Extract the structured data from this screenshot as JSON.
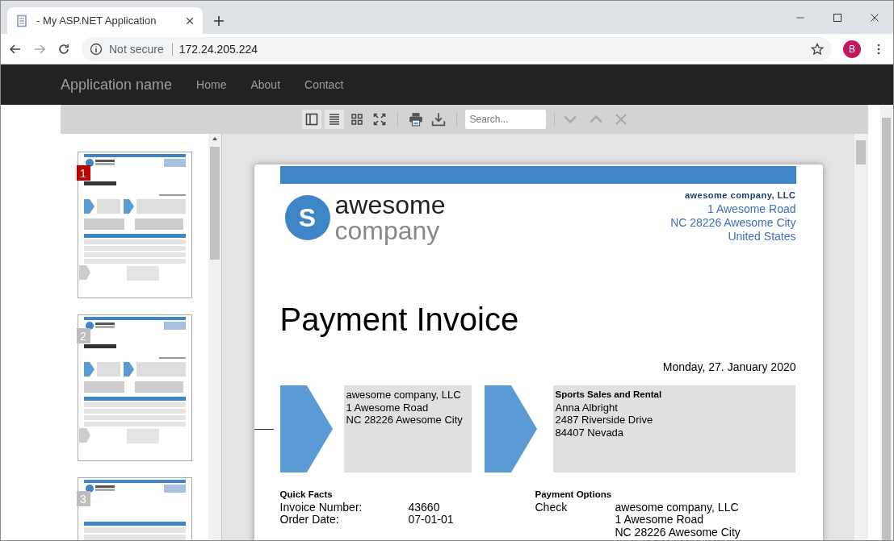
{
  "browser": {
    "tab_title": "- My ASP.NET Application",
    "security": "Not secure",
    "url": "172.24.205.224",
    "profile_initial": "B"
  },
  "navbar": {
    "brand": "Application name",
    "links": [
      "Home",
      "About",
      "Contact"
    ]
  },
  "toolbar": {
    "search": {
      "placeholder": "Search..."
    },
    "buttons": [
      {
        "kind": "sidebar",
        "selected": true
      },
      {
        "kind": "continuous",
        "selected": true
      },
      {
        "kind": "grid",
        "selected": false
      },
      {
        "kind": "fullscreen",
        "selected": false
      },
      {
        "kind": "print",
        "selected": false
      },
      {
        "kind": "download",
        "selected": false
      }
    ]
  },
  "thumbnails": [
    {
      "number": "1",
      "selected": true,
      "kind": "cover"
    },
    {
      "number": "2",
      "selected": false,
      "kind": "cover"
    },
    {
      "number": "3",
      "selected": false,
      "kind": "table"
    }
  ],
  "invoice": {
    "logo": {
      "line_1": "awesome",
      "line_2": "company",
      "letter": "S"
    },
    "sender_header": [
      "awesome company, LLC",
      "1 Awesome Road",
      "NC 28226 Awesome City",
      "United States"
    ],
    "title": "Payment Invoice",
    "date": "Monday, 27. January 2020",
    "from_address": [
      "awesome company, LLC",
      "1 Awesome Road",
      "NC 28226 Awesome City"
    ],
    "to_address": {
      "name": "Sports Sales and Rental",
      "lines": [
        "Anna Albright",
        "2487 Riverside Drive",
        "84407 Nevada"
      ]
    },
    "quick_facts": {
      "heading": "Quick Facts",
      "rows": [
        {
          "label": "Invoice Number:",
          "value": "43660"
        },
        {
          "label": "Order Date:",
          "value": "07-01-01"
        }
      ]
    },
    "payment_options": {
      "heading": "Payment Options",
      "method": "Check",
      "lines": [
        "awesome company, LLC",
        "1 Awesome Road",
        "NC 28226 Awesome City"
      ]
    }
  }
}
